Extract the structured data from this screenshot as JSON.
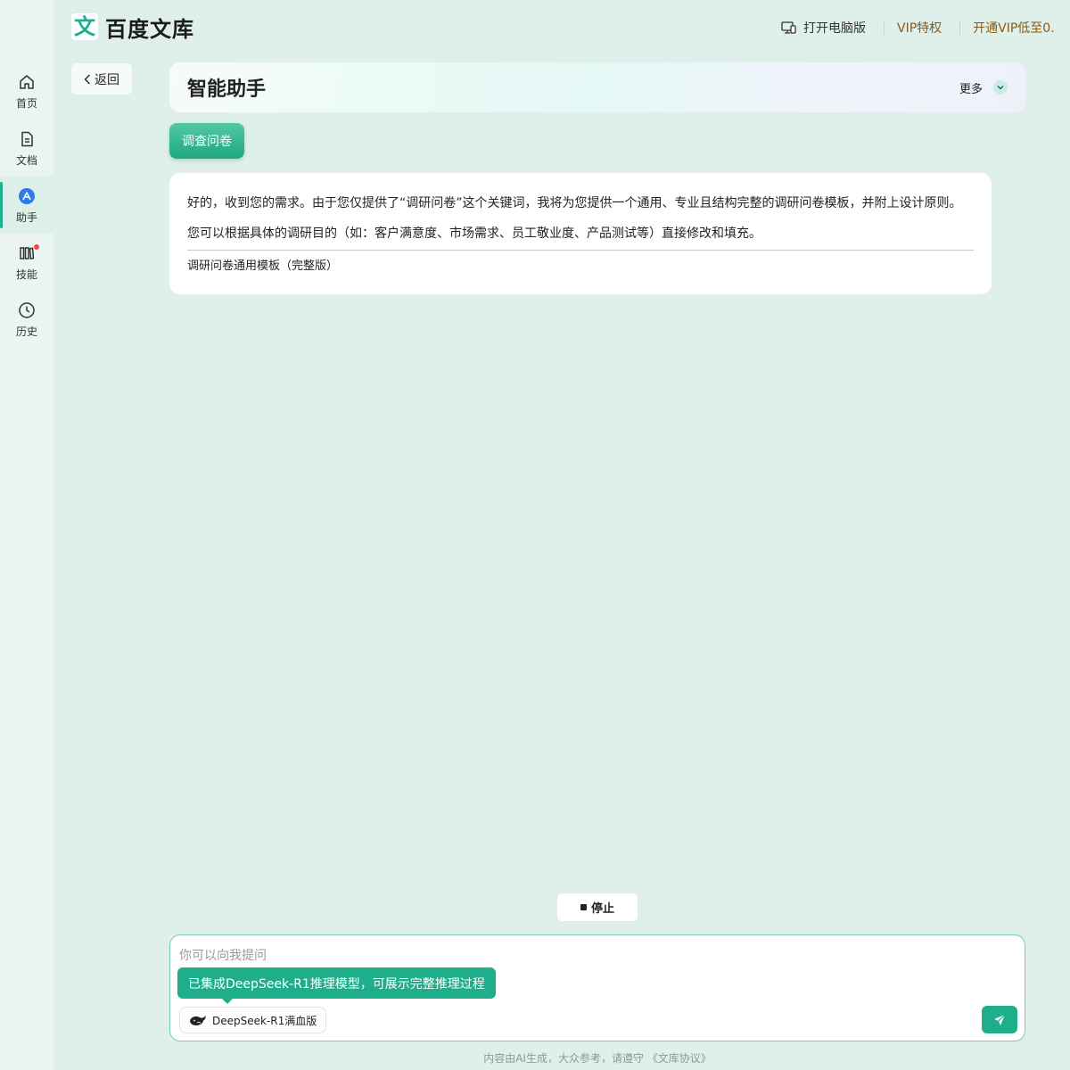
{
  "logo": {
    "mark": "文",
    "text": "百度文库"
  },
  "topbar": {
    "pc_label": "打开电脑版",
    "vip_label": "VIP特权",
    "open_vip_label": "开通VIP低至0."
  },
  "sidebar": {
    "items": [
      {
        "label": "首页",
        "icon": "home-icon"
      },
      {
        "label": "文档",
        "icon": "document-icon"
      },
      {
        "label": "助手",
        "icon": "assistant-icon",
        "active": true
      },
      {
        "label": "技能",
        "icon": "skills-icon",
        "badge": true
      },
      {
        "label": "历史",
        "icon": "history-icon"
      }
    ]
  },
  "back": {
    "label": "返回"
  },
  "header": {
    "title": "智能助手",
    "more_label": "更多"
  },
  "topic": {
    "label": "调查问卷"
  },
  "answer": {
    "para1": "好的，收到您的需求。由于您仅提供了“调研问卷”这个关键词，我将为您提供一个通用、专业且结构完整的调研问卷模板，并附上设计原则。",
    "para2": "您可以根据具体的调研目的（如：客户满意度、市场需求、员工敬业度、产品测试等）直接修改和填充。",
    "subheading": "调研问卷通用模板（完整版）"
  },
  "stop": {
    "label": "停止"
  },
  "input": {
    "placeholder": "你可以向我提问",
    "tooltip": "已集成DeepSeek-R1推理模型，可展示完整推理过程",
    "model_label": "DeepSeek-R1满血版"
  },
  "footer": {
    "text": "内容由AI生成，大众参考，请遵守 《文库协议》"
  },
  "colors": {
    "accent": "#1fae8c",
    "vip": "#8a5a18",
    "badge": "#f04a3c"
  }
}
